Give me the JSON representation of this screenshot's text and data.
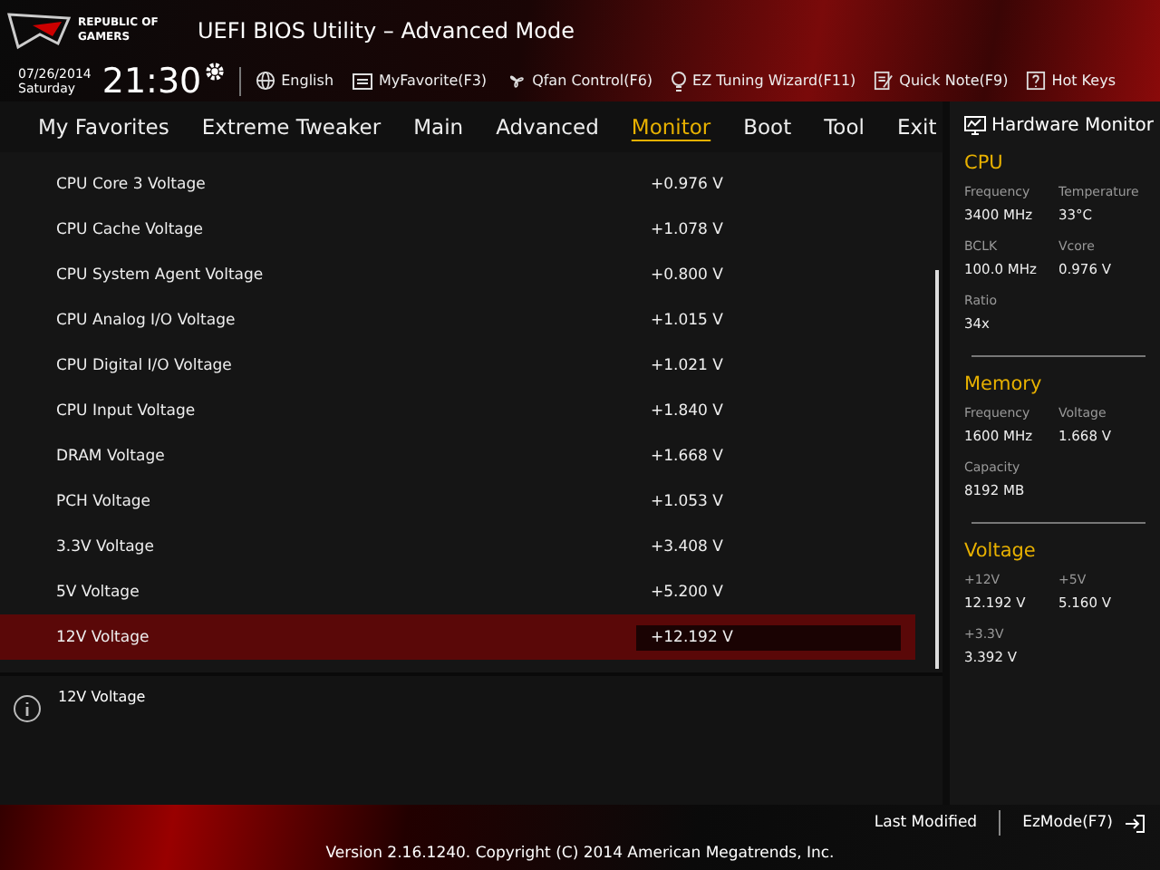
{
  "window": {
    "logo_text": "REPUBLIC OF GAMERS",
    "title": "UEFI BIOS Utility – Advanced Mode"
  },
  "toolbar": {
    "date": "07/26/2014",
    "day": "Saturday",
    "time": "21:30",
    "items": [
      {
        "kind": "globe",
        "label": "English"
      },
      {
        "kind": "star",
        "label": "MyFavorite(F3)"
      },
      {
        "kind": "fan",
        "label": "Qfan Control(F6)"
      },
      {
        "kind": "bulb",
        "label": "EZ Tuning Wizard(F11)"
      },
      {
        "kind": "note",
        "label": "Quick Note(F9)"
      },
      {
        "kind": "help",
        "label": "Hot Keys"
      }
    ]
  },
  "tabs": [
    {
      "label": "My Favorites",
      "selected": false
    },
    {
      "label": "Extreme Tweaker",
      "selected": false
    },
    {
      "label": "Main",
      "selected": false
    },
    {
      "label": "Advanced",
      "selected": false
    },
    {
      "label": "Monitor",
      "selected": true
    },
    {
      "label": "Boot",
      "selected": false
    },
    {
      "label": "Tool",
      "selected": false
    },
    {
      "label": "Exit",
      "selected": false
    }
  ],
  "settings": [
    {
      "name": "CPU Core 3 Voltage",
      "value": "+0.976 V",
      "selected": false
    },
    {
      "name": "CPU Cache Voltage",
      "value": "+1.078 V",
      "selected": false
    },
    {
      "name": "CPU System Agent Voltage",
      "value": "+0.800 V",
      "selected": false
    },
    {
      "name": "CPU Analog I/O Voltage",
      "value": "+1.015 V",
      "selected": false
    },
    {
      "name": "CPU Digital I/O Voltage",
      "value": "+1.021 V",
      "selected": false
    },
    {
      "name": "CPU Input Voltage",
      "value": "+1.840 V",
      "selected": false
    },
    {
      "name": "DRAM Voltage",
      "value": "+1.668 V",
      "selected": false
    },
    {
      "name": "PCH Voltage",
      "value": "+1.053 V",
      "selected": false
    },
    {
      "name": "3.3V Voltage",
      "value": "+3.408 V",
      "selected": false
    },
    {
      "name": "5V Voltage",
      "value": "+5.200 V",
      "selected": false
    },
    {
      "name": "12V Voltage",
      "value": "+12.192 V",
      "selected": true
    }
  ],
  "help": {
    "text": "12V Voltage"
  },
  "hardware_monitor": {
    "title": "Hardware Monitor",
    "sections": [
      {
        "title": "CPU",
        "readings": [
          {
            "label": "Frequency",
            "value": "3400 MHz"
          },
          {
            "label": "Temperature",
            "value": "33°C"
          },
          {
            "label": "BCLK",
            "value": "100.0 MHz"
          },
          {
            "label": "Vcore",
            "value": "0.976 V"
          },
          {
            "label": "Ratio",
            "value": "34x"
          }
        ]
      },
      {
        "title": "Memory",
        "readings": [
          {
            "label": "Frequency",
            "value": "1600 MHz"
          },
          {
            "label": "Voltage",
            "value": "1.668 V"
          },
          {
            "label": "Capacity",
            "value": "8192 MB"
          }
        ]
      },
      {
        "title": "Voltage",
        "readings": [
          {
            "label": "+12V",
            "value": "12.192 V"
          },
          {
            "label": "+5V",
            "value": "5.160 V"
          },
          {
            "label": "+3.3V",
            "value": "3.392 V"
          }
        ]
      }
    ]
  },
  "footer": {
    "last_modified": "Last Modified",
    "ez_mode": "EzMode(F7)",
    "version": "Version 2.16.1240. Copyright (C) 2014 American Megatrends, Inc."
  }
}
